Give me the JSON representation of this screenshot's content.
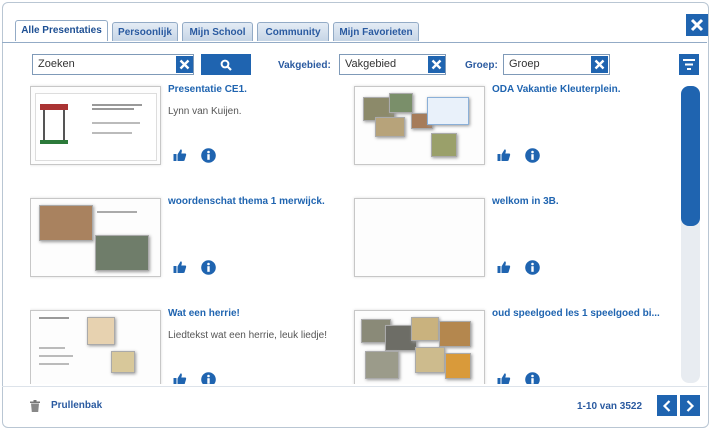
{
  "tabs": [
    "Alle Presentaties",
    "Persoonlijk",
    "Mijn School",
    "Community",
    "Mijn Favorieten"
  ],
  "search": {
    "value": "Zoeken"
  },
  "filters": {
    "vakgebied_label": "Vakgebied:",
    "vakgebied_value": "Vakgebied",
    "groep_label": "Groep:",
    "groep_value": "Groep"
  },
  "items": [
    {
      "title": "Presentatie CE1.",
      "desc": "Lynn van Kuijen."
    },
    {
      "title": "ODA Vakantie Kleuterplein.",
      "desc": ""
    },
    {
      "title": "woordenschat thema 1  merwijck.",
      "desc": ""
    },
    {
      "title": "welkom in 3B.",
      "desc": ""
    },
    {
      "title": "Wat een herrie!",
      "desc": "Liedtekst wat een herrie, leuk liedje!"
    },
    {
      "title": "oud speelgoed les 1 speelgoed bi...",
      "desc": ""
    }
  ],
  "footer": {
    "trash_label": "Prullenbak",
    "pagination": "1-10 van 3522"
  },
  "colors": {
    "accent": "#1f64b0",
    "tab_text": "#2a5aa0"
  },
  "icons": [
    "close-icon",
    "clear-icon",
    "search-icon",
    "menu-icon",
    "thumbs-up-icon",
    "info-icon",
    "trash-icon",
    "chevron-left-icon",
    "chevron-right-icon"
  ]
}
